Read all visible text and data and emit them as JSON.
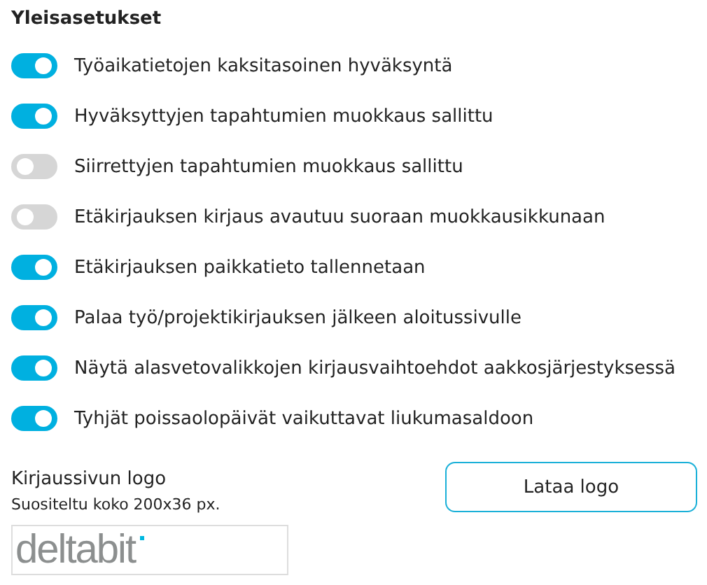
{
  "section_title": "Yleisasetukset",
  "settings": [
    {
      "label": "Työaikatietojen kaksitasoinen hyväksyntä",
      "on": true
    },
    {
      "label": "Hyväksyttyjen tapahtumien muokkaus sallittu",
      "on": true
    },
    {
      "label": "Siirrettyjen tapahtumien muokkaus sallittu",
      "on": false
    },
    {
      "label": "Etäkirjauksen kirjaus avautuu suoraan muokkausikkunaan",
      "on": false
    },
    {
      "label": "Etäkirjauksen paikkatieto tallennetaan",
      "on": true
    },
    {
      "label": "Palaa työ/projektikirjauksen jälkeen aloitussivulle",
      "on": true
    },
    {
      "label": "Näytä alasvetovalikkojen kirjausvaihtoehdot aakkosjärjestyksessä",
      "on": true
    },
    {
      "label": "Tyhjät poissaolopäivät vaikuttavat liukumasaldoon",
      "on": true
    }
  ],
  "logo_section": {
    "title": "Kirjaussivun logo",
    "hint": "Suositeltu koko 200x36 px.",
    "logo_text": "deltabit",
    "button": "Lataa logo"
  }
}
